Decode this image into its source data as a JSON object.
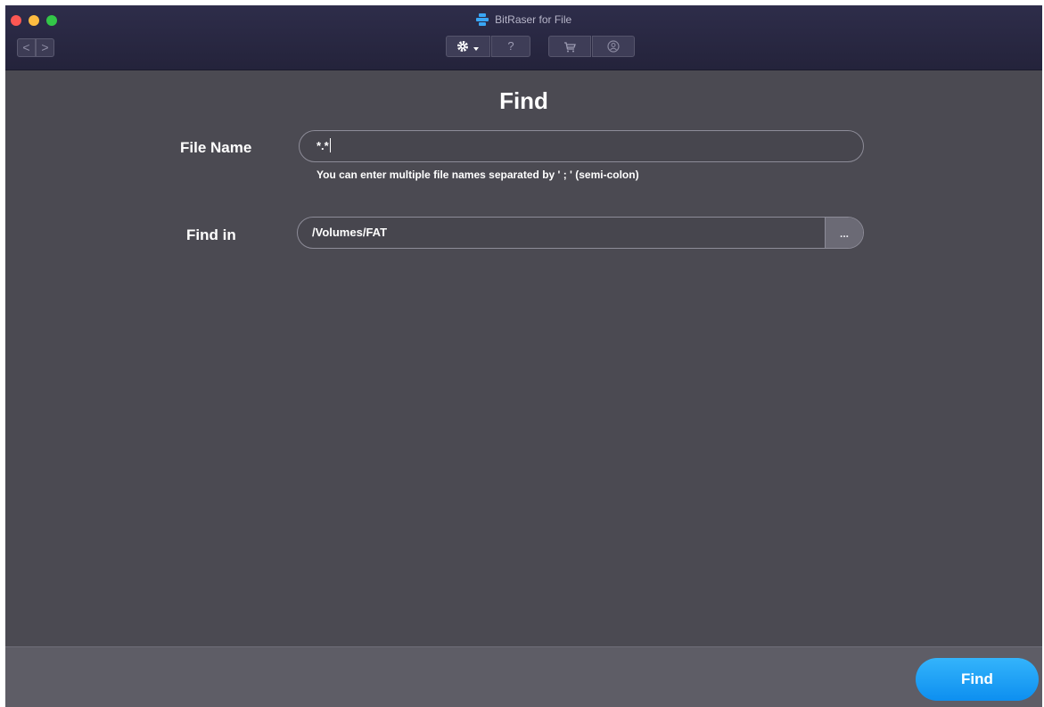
{
  "window": {
    "app_title": "BitRaser for File",
    "nav": {
      "back": "<",
      "forward": ">"
    },
    "toolbar": {
      "help": "?"
    }
  },
  "page": {
    "title": "Find",
    "file_name": {
      "label": "File Name",
      "value": "*.*",
      "hint": "You can enter multiple file names separated by ' ; ' (semi-colon)"
    },
    "find_in": {
      "label": "Find in",
      "value": "/Volumes/FAT",
      "browse": "..."
    }
  },
  "footer": {
    "find_button": "Find"
  },
  "colors": {
    "accent": "#1a9cf6",
    "background": "#4b4a52",
    "titlebar": "#2b2a45"
  }
}
